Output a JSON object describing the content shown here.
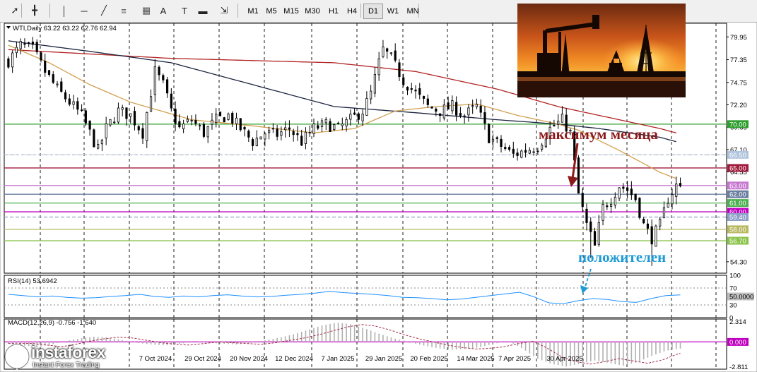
{
  "toolbar": {
    "tools": [
      "cursor-icon",
      "crosshair-icon",
      "vertical-line-icon",
      "horizontal-line-icon",
      "trendline-icon",
      "fibonacci-icon",
      "grid-icon",
      "text-icon",
      "label-icon",
      "rectangle-icon",
      "arrows-icon"
    ],
    "text_tool_label": "A",
    "label_tool_label": "T",
    "timeframes": [
      "M1",
      "M5",
      "M15",
      "M30",
      "H1",
      "H4",
      "D1",
      "W1",
      "MN"
    ],
    "active_timeframe": "D1"
  },
  "logo": {
    "name": "instaforex",
    "tagline": "Instant Forex Trading"
  },
  "chart_data": [
    {
      "type": "candlestick",
      "title": "WTI,Daily  63.22 63.22 62.76 62.94",
      "ylim": [
        53.0,
        81.5
      ],
      "yticks": [
        "79.95",
        "77.35",
        "74.75",
        "72.20",
        "69.65",
        "67.10",
        "64.55",
        "59.40",
        "54.30"
      ],
      "xticks": [
        "7 Oct 2024",
        "29 Oct 2024",
        "20 Nov 2024",
        "12 Dec 2024",
        "7 Jan 2025",
        "29 Jan 2025",
        "20 Feb 2025",
        "14 Mar 2025",
        "7 Apr 2025",
        "30 Apr 2025"
      ],
      "close_path": [
        [
          0,
          77.2
        ],
        [
          3,
          79.0
        ],
        [
          6,
          78.5
        ],
        [
          9,
          76.0
        ],
        [
          12,
          74.0
        ],
        [
          15,
          72.5
        ],
        [
          18,
          71.0
        ],
        [
          20,
          69.0
        ],
        [
          22,
          67.0
        ],
        [
          24,
          69.5
        ],
        [
          27,
          71.5
        ],
        [
          30,
          71.0
        ],
        [
          33,
          69.0
        ],
        [
          36,
          76.0
        ],
        [
          38,
          74.5
        ],
        [
          40,
          71.5
        ],
        [
          42,
          69.5
        ],
        [
          45,
          70.5
        ],
        [
          48,
          69.0
        ],
        [
          51,
          70.5
        ],
        [
          54,
          71.0
        ],
        [
          57,
          69.5
        ],
        [
          60,
          68.0
        ],
        [
          63,
          69.0
        ],
        [
          66,
          68.8
        ],
        [
          69,
          69.5
        ],
        [
          72,
          68.0
        ],
        [
          75,
          69.5
        ],
        [
          78,
          70.0
        ],
        [
          81,
          69.5
        ],
        [
          84,
          70.5
        ],
        [
          87,
          71.5
        ],
        [
          89,
          73.5
        ],
        [
          91,
          77.0
        ],
        [
          92,
          78.5
        ],
        [
          94,
          77.5
        ],
        [
          97,
          75.0
        ],
        [
          100,
          73.5
        ],
        [
          103,
          72.0
        ],
        [
          106,
          71.5
        ],
        [
          109,
          72.0
        ],
        [
          112,
          71.0
        ],
        [
          115,
          72.0
        ],
        [
          118,
          68.5
        ],
        [
          121,
          67.5
        ],
        [
          124,
          66.5
        ],
        [
          127,
          67.0
        ],
        [
          130,
          67.5
        ],
        [
          133,
          69.5
        ],
        [
          136,
          70.5
        ],
        [
          138,
          69.0
        ],
        [
          140,
          62.0
        ],
        [
          142,
          58.5
        ],
        [
          144,
          56.0
        ],
        [
          146,
          60.5
        ],
        [
          148,
          61.5
        ],
        [
          150,
          63.0
        ],
        [
          152,
          62.5
        ],
        [
          154,
          61.5
        ],
        [
          156,
          58.5
        ],
        [
          158,
          57.0
        ],
        [
          160,
          58.5
        ],
        [
          162,
          61.5
        ],
        [
          164,
          63.0
        ],
        [
          165,
          62.94
        ]
      ],
      "high_path": [
        [
          0,
          79.5
        ],
        [
          9,
          78.0
        ],
        [
          24,
          67.0
        ],
        [
          36,
          78.0
        ],
        [
          63,
          69.8
        ],
        [
          92,
          79.5
        ],
        [
          118,
          72.5
        ],
        [
          124,
          65.5
        ],
        [
          139,
          71.5
        ],
        [
          143,
          55.0
        ],
        [
          150,
          64.5
        ],
        [
          158,
          55.5
        ],
        [
          165,
          63.22
        ]
      ],
      "ma_fast": [
        [
          0,
          79.0
        ],
        [
          10,
          77.0
        ],
        [
          20,
          74.5
        ],
        [
          30,
          72.5
        ],
        [
          45,
          70.5
        ],
        [
          60,
          69.8
        ],
        [
          75,
          69.0
        ],
        [
          85,
          69.5
        ],
        [
          95,
          71.5
        ],
        [
          105,
          72.0
        ],
        [
          115,
          72.3
        ],
        [
          125,
          71.0
        ],
        [
          135,
          70.0
        ],
        [
          140,
          69.3
        ],
        [
          150,
          67.0
        ],
        [
          160,
          64.5
        ],
        [
          164,
          63.8
        ]
      ],
      "ma_mid": [
        [
          0,
          79.5
        ],
        [
          20,
          78.3
        ],
        [
          40,
          77.0
        ],
        [
          60,
          74.5
        ],
        [
          80,
          72.0
        ],
        [
          100,
          71.3
        ],
        [
          120,
          70.5
        ],
        [
          135,
          70.0
        ],
        [
          145,
          69.5
        ],
        [
          160,
          68.5
        ],
        [
          164,
          68.0
        ]
      ],
      "ma_slow": [
        [
          0,
          78.5
        ],
        [
          40,
          77.5
        ],
        [
          80,
          77.0
        ],
        [
          100,
          76.0
        ],
        [
          120,
          74.0
        ],
        [
          135,
          72.0
        ],
        [
          150,
          70.5
        ],
        [
          160,
          69.5
        ],
        [
          164,
          69.0
        ]
      ],
      "levels": [
        {
          "value": 70.0,
          "label": "70.00",
          "color": "#2e9e2e"
        },
        {
          "value": 66.5,
          "label": "66.50",
          "color": "#b0c4de"
        },
        {
          "value": 65.0,
          "label": "65.00",
          "color": "#a01a3c"
        },
        {
          "value": 63.0,
          "label": "63.00",
          "color": "#c779d0"
        },
        {
          "value": 62.0,
          "label": "62.00",
          "color": "#6b7fa0"
        },
        {
          "value": 61.0,
          "label": "61.00",
          "color": "#4caf50"
        },
        {
          "value": 60.0,
          "label": "60.00",
          "color": "#c000c0"
        },
        {
          "value": 59.4,
          "label": "59.40",
          "color": "#8ea0c8"
        },
        {
          "value": 58.0,
          "label": "58.00",
          "color": "#b8b860"
        },
        {
          "value": 56.7,
          "label": "56.70",
          "color": "#8bc34a"
        }
      ],
      "annotations": [
        {
          "text": "максимум месяца",
          "color": "#8b1a1a"
        },
        {
          "text": "положителен",
          "color": "#1e9ad6"
        }
      ]
    },
    {
      "type": "line",
      "title": "RSI(14) 53.6942",
      "ylim": [
        0,
        100
      ],
      "yticks": [
        "100",
        "70",
        "50.0000",
        "30",
        "0"
      ],
      "series": [
        {
          "values": [
            55,
            52,
            49,
            51,
            48,
            46,
            47,
            50,
            52,
            55,
            50,
            48,
            51,
            49,
            52,
            54,
            51,
            49,
            50,
            53,
            55,
            58,
            62,
            59,
            57,
            55,
            52,
            48,
            47,
            45,
            42,
            44,
            48,
            52,
            56,
            60,
            49,
            35,
            33,
            40,
            45,
            43,
            38,
            36,
            45,
            52,
            53.7
          ]
        }
      ]
    },
    {
      "type": "bar",
      "title": "MACD(12,26,9) -0.756 -1.640",
      "ylim": [
        -3.1,
        2.6
      ],
      "yticks": [
        "2.314",
        "0.000",
        "-2.811"
      ],
      "series": [
        {
          "values": [
            -0.2,
            -0.4,
            -0.6,
            -0.3,
            0.1,
            0.4,
            0.6,
            0.5,
            0.2,
            -0.1,
            -0.3,
            -0.4,
            -0.2,
            0.0,
            -0.1,
            -0.2,
            -0.3,
            -0.1,
            0.2,
            0.5,
            0.9,
            1.4,
            1.9,
            2.2,
            2.0,
            1.5,
            0.9,
            0.4,
            0.0,
            -0.4,
            -0.7,
            -0.9,
            -0.8,
            -0.6,
            -0.2,
            0.1,
            -0.8,
            -1.9,
            -2.5,
            -2.8,
            -2.5,
            -2.1,
            -2.4,
            -2.7,
            -2.3,
            -1.6,
            -1.0,
            -0.756
          ]
        }
      ]
    }
  ]
}
